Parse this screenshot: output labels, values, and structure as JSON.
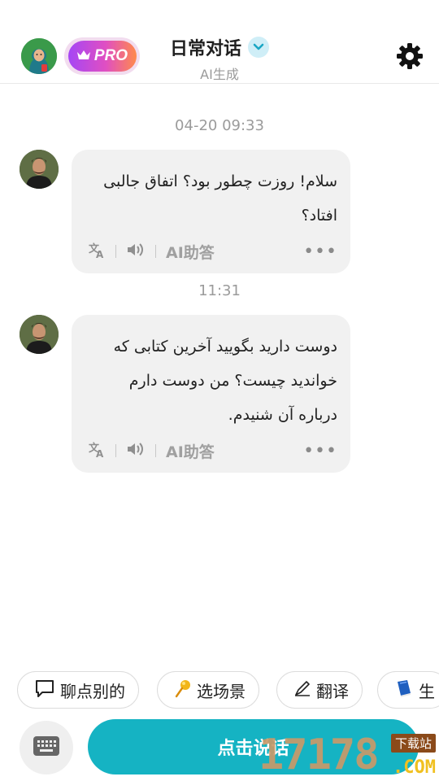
{
  "header": {
    "pro_label": "PRO",
    "title": "日常对话",
    "subtitle": "AI生成"
  },
  "messages": [
    {
      "timestamp": "04-20 09:33",
      "text": "سلام! روزت چطور بود؟ اتفاق جالبی افتاد؟",
      "ai_label": "AI助答",
      "more_label": "•••"
    },
    {
      "timestamp": "11:31",
      "text": "دوست دارید بگویید آخرین کتابی که خواندید چیست؟ من دوست دارم درباره آن شنیدم.",
      "ai_label": "AI助答",
      "more_label": "•••"
    }
  ],
  "chips": [
    {
      "label": "聊点别的",
      "icon": "speech-bubble-icon"
    },
    {
      "label": "选场景",
      "icon": "pin-icon"
    },
    {
      "label": "翻译",
      "icon": "pen-icon"
    },
    {
      "label": "生",
      "icon": "book-icon"
    }
  ],
  "bottom": {
    "talk_label": "点击说话"
  },
  "watermark": {
    "number": "17178",
    "tag": "下载站",
    "domain": ".COM"
  },
  "colors": {
    "accent": "#15b3c3",
    "bubble": "#f1f1f1",
    "pro_gradient_start": "#a546f5",
    "pro_gradient_end": "#ff8a4c"
  }
}
